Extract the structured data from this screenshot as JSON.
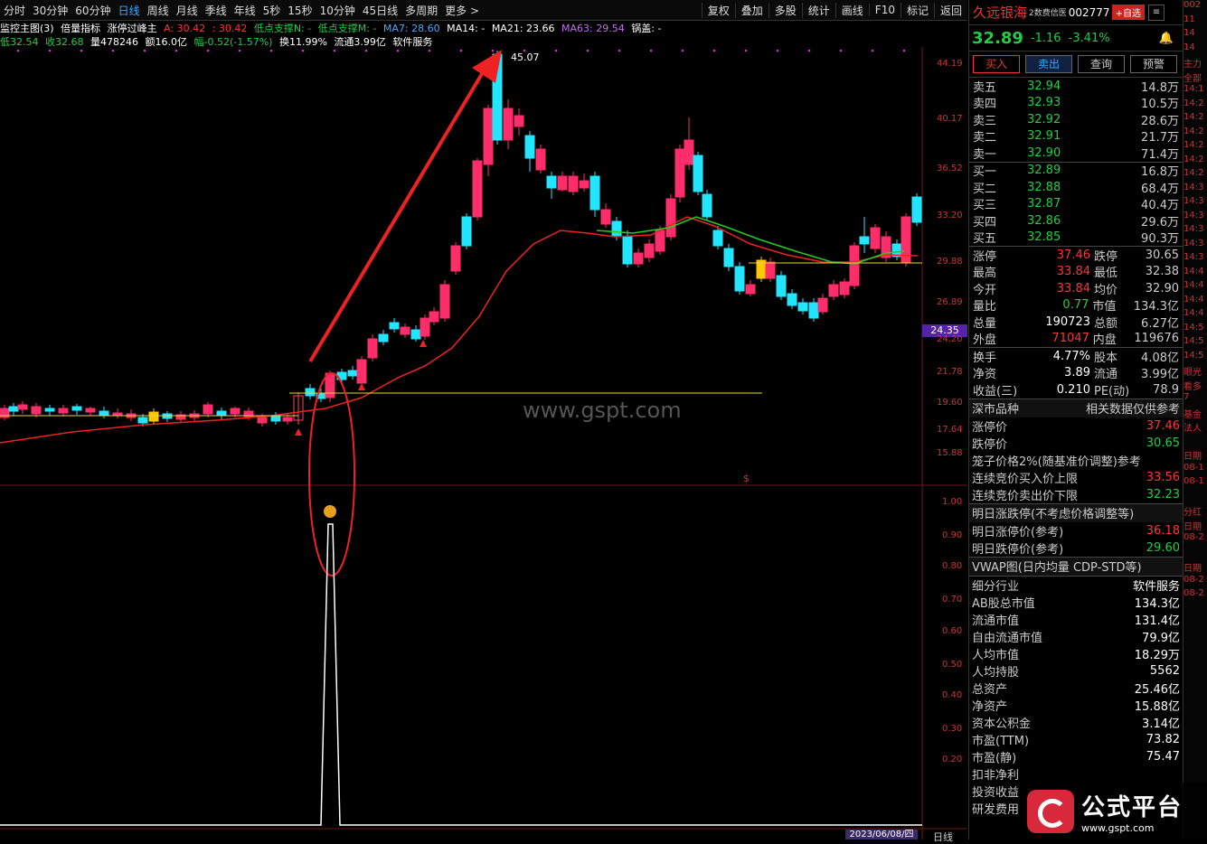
{
  "toolbar": {
    "periods": [
      "分时",
      "30分钟",
      "60分钟",
      "日线",
      "周线",
      "月线",
      "季线",
      "年线",
      "5秒",
      "15秒",
      "10分钟",
      "45日线",
      "多周期",
      "更多 >"
    ],
    "active_period": "日线",
    "right": [
      "复权",
      "叠加",
      "多股",
      "统计",
      "画线",
      "F10",
      "标记",
      "返回"
    ]
  },
  "info_line1": {
    "chart_name": "监控主图(3)",
    "menu": "倍量指标",
    "indicator": "涨停过峰主",
    "a_label": "A: 30.42",
    "a2_label": ": 30.42",
    "low_support_n": "低点支撑N: -",
    "low_support_m": "低点支撑M: -",
    "ma7": "MA7: 28.60",
    "ma14": "MA14: -",
    "ma21": "MA21: 23.66",
    "ma63": "MA63: 29.54",
    "guo_gai": "锅盖: -"
  },
  "info_line2": {
    "low": "低32.54",
    "close": "收32.68",
    "volume": "量478246",
    "amount": "额16.0亿",
    "change": "幅-0.52(-1.57%)",
    "turnover": "换11.99%",
    "float_mv": "流通3.99亿",
    "industry": "软件服务"
  },
  "price_axis": [
    "44.19",
    "40.17",
    "36.52",
    "33.20",
    "29.88",
    "26.89",
    "24.20",
    "21.78",
    "19.60",
    "17.64",
    "15.88"
  ],
  "indicator_axis": [
    "1.00",
    "0.90",
    "0.80",
    "0.70",
    "0.60",
    "0.50",
    "0.40",
    "0.30",
    "0.20"
  ],
  "current_price_tag": "24.35",
  "peak_label": "45.07",
  "watermark": "www.gspt.com",
  "dollar_mark": "$",
  "date_box": "2023/06/08/四",
  "bottom_right_label": "日线",
  "panel": {
    "name": "久远银海",
    "badge": "2数费信医",
    "code": "002777",
    "add_label": "+自选",
    "menu_icon": "≡",
    "last": "32.89",
    "chg": "-1.16",
    "pct": "-3.41%",
    "bell": "🔔",
    "btns": {
      "buy": "买入",
      "sell": "卖出",
      "query": "查询",
      "alert": "预警"
    },
    "asks": [
      {
        "l": "卖五",
        "p": "32.94",
        "v": "14.8万"
      },
      {
        "l": "卖四",
        "p": "32.93",
        "v": "10.5万"
      },
      {
        "l": "卖三",
        "p": "32.92",
        "v": "28.6万"
      },
      {
        "l": "卖二",
        "p": "32.91",
        "v": "21.7万"
      },
      {
        "l": "卖一",
        "p": "32.90",
        "v": "71.4万"
      }
    ],
    "bids": [
      {
        "l": "买一",
        "p": "32.89",
        "v": "16.8万"
      },
      {
        "l": "买二",
        "p": "32.88",
        "v": "68.4万"
      },
      {
        "l": "买三",
        "p": "32.87",
        "v": "40.4万"
      },
      {
        "l": "买四",
        "p": "32.86",
        "v": "29.6万"
      },
      {
        "l": "买五",
        "p": "32.85",
        "v": "90.3万"
      }
    ],
    "quote": [
      {
        "l1": "涨停",
        "v1": "37.46",
        "c1": "red",
        "l2": "跌停",
        "v2": "30.65",
        "c2": "green"
      },
      {
        "l1": "最高",
        "v1": "33.84",
        "c1": "red",
        "l2": "最低",
        "v2": "32.38",
        "c2": "green"
      },
      {
        "l1": "今开",
        "v1": "33.84",
        "c1": "red",
        "l2": "均价",
        "v2": "32.90",
        "c2": "green"
      },
      {
        "l1": "量比",
        "v1": "0.77",
        "c1": "green",
        "l2": "市值",
        "v2": "134.3亿",
        "c2": "white"
      },
      {
        "l1": "总量",
        "v1": "190723",
        "c1": "white",
        "l2": "总额",
        "v2": "6.27亿",
        "c2": "blue"
      },
      {
        "l1": "外盘",
        "v1": "71047",
        "c1": "red",
        "l2": "内盘",
        "v2": "119676",
        "c2": "green"
      }
    ],
    "fund": [
      {
        "l1": "换手",
        "v1": "4.77%",
        "l2": "股本",
        "v2": "4.08亿"
      },
      {
        "l1": "净资",
        "v1": "3.89",
        "l2": "流通",
        "v2": "3.99亿"
      },
      {
        "l1": "收益(三)",
        "v1": "0.210",
        "l2": "PE(动)",
        "v2": "78.9"
      }
    ],
    "market_title": "深市品种",
    "market_note": "相关数据仅供参考",
    "limits": [
      {
        "k": "涨停价",
        "v": "37.46",
        "c": "red"
      },
      {
        "k": "跌停价",
        "v": "30.65",
        "c": "green"
      },
      {
        "k": "笼子价格2%(随基准价调整)参考",
        "v": "",
        "c": "white"
      },
      {
        "k": "连续竞价买入价上限",
        "v": "33.56",
        "c": "red"
      },
      {
        "k": "连续竞价卖出价下限",
        "v": "32.23",
        "c": "green"
      }
    ],
    "tomorrow_title": "明日涨跌停(不考虑价格调整等)",
    "tomorrow": [
      {
        "k": "明日涨停价(参考)",
        "v": "36.18",
        "c": "red"
      },
      {
        "k": "明日跌停价(参考)",
        "v": "29.60",
        "c": "green"
      }
    ],
    "vwap_title": "VWAP图(日内均量 CDP-STD等)",
    "industry_row": {
      "k": "细分行业",
      "v": "软件服务"
    },
    "stats": [
      {
        "k": "AB股总市值",
        "v": "134.3亿"
      },
      {
        "k": "流通市值",
        "v": "131.4亿"
      },
      {
        "k": "自由流通市值",
        "v": "79.9亿"
      },
      {
        "k": "人均市值",
        "v": "18.29万"
      },
      {
        "k": "人均持股",
        "v": "5562"
      },
      {
        "k": "总资产",
        "v": "25.46亿"
      },
      {
        "k": "净资产",
        "v": "15.88亿"
      },
      {
        "k": "资本公积金",
        "v": "3.14亿"
      },
      {
        "k": "市盈(TTM)",
        "v": "73.82"
      },
      {
        "k": "市盈(静)",
        "v": "75.47"
      },
      {
        "k": "扣非净利",
        "v": ""
      },
      {
        "k": "投资收益",
        "v": ""
      },
      {
        "k": "研发费用",
        "v": ""
      }
    ]
  },
  "strip": [
    "002",
    "11",
    "14",
    "14",
    "主力",
    "全部",
    "14:1",
    "14:2",
    "14:2",
    "14:2",
    "14:2",
    "14:2",
    "14:2",
    "14:3",
    "14:3",
    "14:3",
    "14:3",
    "14:3",
    "14:3",
    "14:4",
    "14:4",
    "14:4",
    "14:4",
    "14:5",
    "14:5",
    "14:5",
    "眼光",
    "看多",
    "7",
    "基金",
    "法人",
    "",
    "日期",
    "08-1",
    "08-1",
    "",
    "分红",
    "日期",
    "08-2",
    "",
    "日期",
    "08-2",
    "08-2"
  ],
  "logo": {
    "main": "公式平台",
    "sub": "www.gspt.com"
  }
}
